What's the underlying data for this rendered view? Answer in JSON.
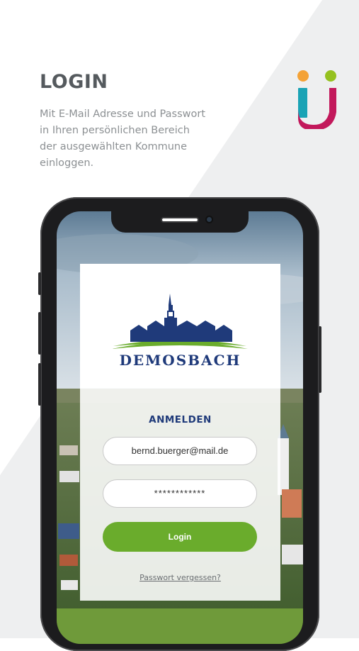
{
  "promo": {
    "title": "LOGIN",
    "description_lines": [
      "Mit E-Mail Adresse und Passwort",
      "in Ihren persönlichen Bereich",
      "der ausgewählten Kommune",
      "einloggen."
    ],
    "logo_icon": "ue-brand-logo"
  },
  "app": {
    "town_logo": "church-town-silhouette-logo",
    "town_name": "DEMOSBACH",
    "form_title": "ANMELDEN",
    "email_value": "bernd.buerger@mail.de",
    "password_value": "************",
    "login_label": "Login",
    "forgot_password_label": "Passwort vergessen?"
  },
  "colors": {
    "brand_navy": "#1f3a7a",
    "login_green": "#6aac2c",
    "heading_gray": "#555a5e",
    "text_gray": "#8c9093"
  }
}
